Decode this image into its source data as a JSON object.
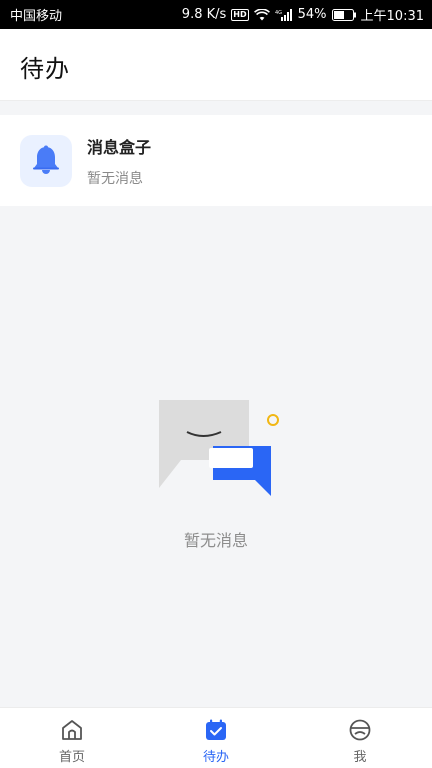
{
  "status_bar": {
    "carrier": "中国移动",
    "net_speed": "9.8 K/s",
    "hd": "HD",
    "network_type": "4G",
    "battery": "54%",
    "time": "上午10:31"
  },
  "header": {
    "title": "待办"
  },
  "message_box": {
    "title": "消息盒子",
    "subtitle": "暂无消息",
    "icon": "bell-icon"
  },
  "empty_state": {
    "text": "暂无消息",
    "icon": "chat-bubbles-illustration"
  },
  "tab_bar": {
    "tabs": [
      {
        "label": "首页",
        "icon": "home-icon",
        "active": false
      },
      {
        "label": "待办",
        "icon": "todo-calendar-icon",
        "active": true
      },
      {
        "label": "我",
        "icon": "profile-icon",
        "active": false
      }
    ]
  },
  "colors": {
    "accent": "#2a66f5",
    "bell": "#4a7cf7",
    "background": "#f4f5f7",
    "empty_bubble_gray": "#dcdcdc",
    "dot_yellow": "#f1b715"
  }
}
